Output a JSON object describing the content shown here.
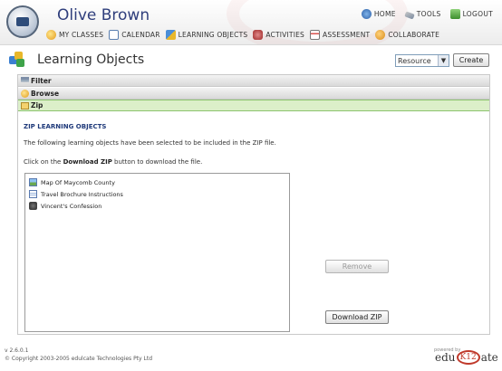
{
  "header": {
    "user_name": "Olive Brown",
    "top_links": [
      "HOME",
      "TOOLS",
      "LOGOUT"
    ],
    "nav": [
      "MY CLASSES",
      "CALENDAR",
      "LEARNING OBJECTS",
      "ACTIVITIES",
      "ASSESSMENT",
      "COLLABORATE"
    ]
  },
  "page": {
    "title": "Learning Objects",
    "resource_select_value": "Resource",
    "create_label": "Create"
  },
  "sections": {
    "filter": "Filter",
    "browse": "Browse",
    "zip": "Zip"
  },
  "zip": {
    "heading": "ZIP LEARNING OBJECTS",
    "description": "The following learning objects have been selected to be included in the ZIP file.",
    "instr_prefix": "Click on the ",
    "instr_bold": "Download ZIP",
    "instr_suffix": " button to download the file.",
    "items": [
      {
        "label": "Map Of Maycomb County",
        "icon": "map-icon"
      },
      {
        "label": "Travel Brochure Instructions",
        "icon": "document-icon"
      },
      {
        "label": "Vincent's Confession",
        "icon": "audio-icon"
      }
    ],
    "remove_label": "Remove",
    "download_label": "Download ZIP"
  },
  "footer": {
    "version": "v 2.6.0.1",
    "copyright": "© Copyright 2003-2005 edulcate Technologies Pty Ltd",
    "powered_by": "powered by",
    "brand_pre": "edu",
    "brand_k": "K12",
    "brand_post": "ate"
  }
}
